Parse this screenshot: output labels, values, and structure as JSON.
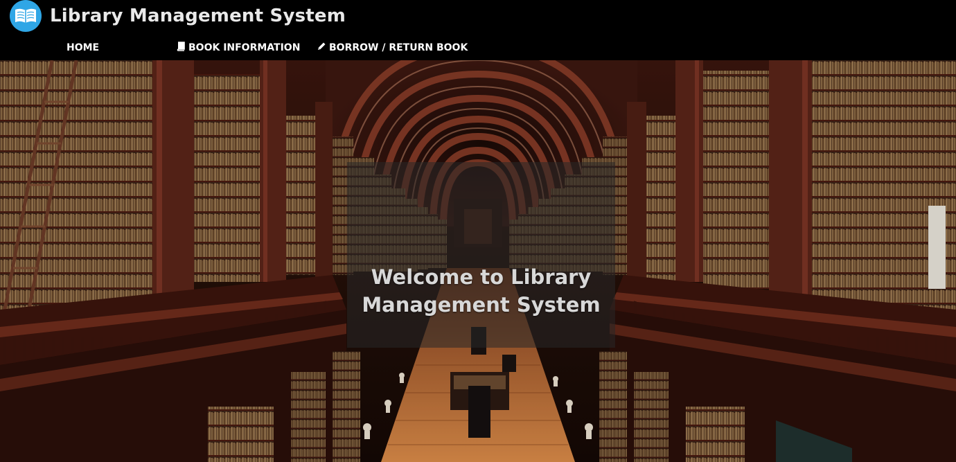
{
  "app": {
    "title": "Library Management System",
    "logo_icon": "open-book-icon",
    "logo_color": "#2fa6e6"
  },
  "nav": {
    "items": [
      {
        "label": "HOME",
        "icon": ""
      },
      {
        "label": "BOOK INFORMATION",
        "icon": "book-icon"
      },
      {
        "label": "BORROW / RETURN BOOK",
        "icon": "pencil-icon"
      }
    ]
  },
  "hero": {
    "line1": "Welcome to Library",
    "line2": "Management System"
  },
  "colors": {
    "header_bg": "#000000",
    "wood": "#5a2418",
    "floor": "#c97a3e"
  }
}
